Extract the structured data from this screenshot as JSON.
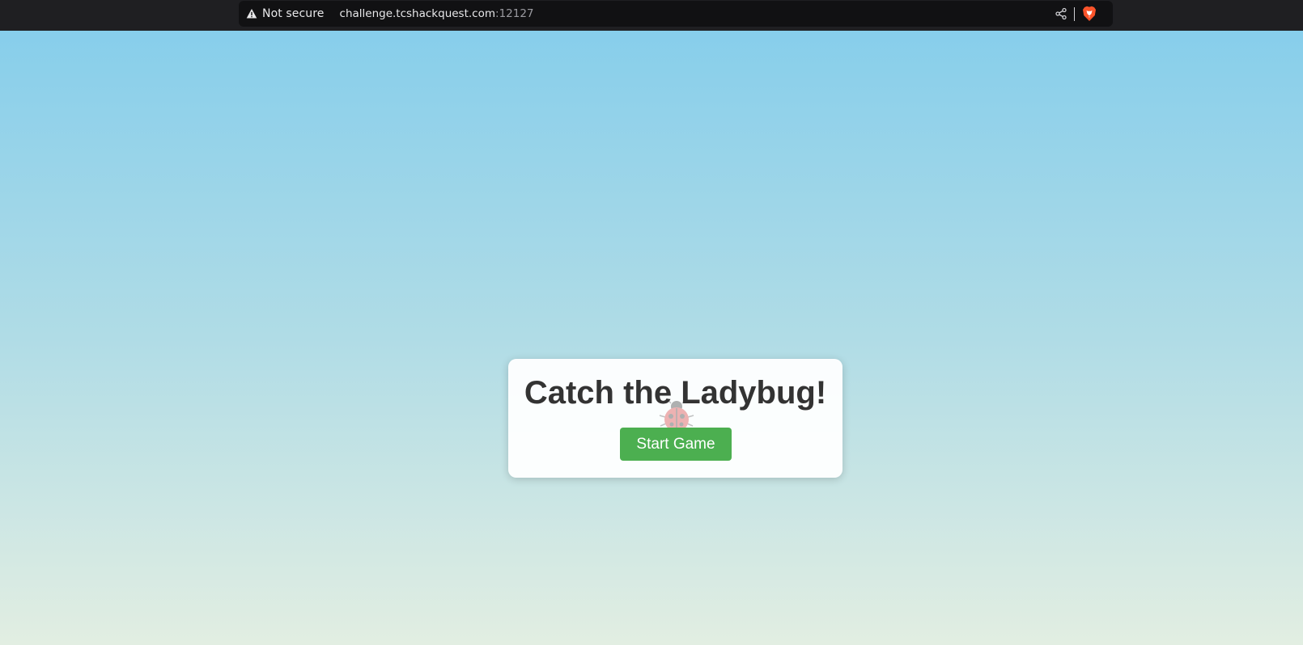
{
  "browser": {
    "security_label": "Not secure",
    "url_host": "challenge.tcshackquest.com",
    "url_port": ":12127",
    "icons": [
      "warning-icon",
      "share-icon",
      "brave-shield-icon"
    ]
  },
  "page": {
    "title": "Catch the Ladybug!",
    "start_button_label": "Start Game",
    "colors": {
      "sky_top": "#87ceeb",
      "sky_bottom": "#e2eee2",
      "button": "#4caf50",
      "title_text": "#333333"
    }
  }
}
